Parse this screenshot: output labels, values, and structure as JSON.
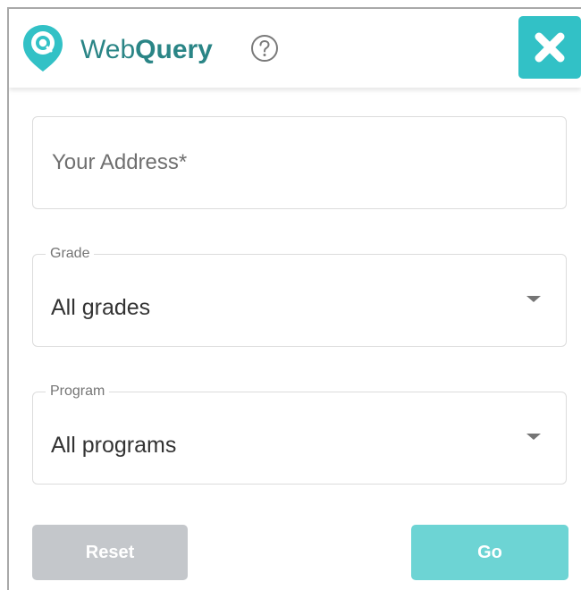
{
  "header": {
    "brand_light": "Web",
    "brand_bold": "Query",
    "logo_icon": "location-pin-search-icon",
    "help_icon": "question-circle-icon",
    "close_icon": "close-x-icon"
  },
  "form": {
    "address": {
      "placeholder": "Your Address*",
      "value": ""
    },
    "grade": {
      "label": "Grade",
      "value": "All grades"
    },
    "program": {
      "label": "Program",
      "value": "All programs"
    }
  },
  "actions": {
    "reset_label": "Reset",
    "go_label": "Go"
  },
  "colors": {
    "brand_text": "#2a8586",
    "accent": "#32c1c6",
    "go_button": "#6dd4d4",
    "reset_button": "#c4c7cb",
    "border": "#dcdcdc"
  }
}
